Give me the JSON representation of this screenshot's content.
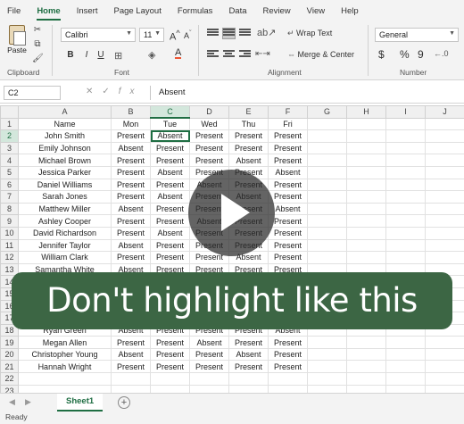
{
  "ribbon": {
    "tabs": [
      "File",
      "Home",
      "Insert",
      "Page Layout",
      "Formulas",
      "Data",
      "Review",
      "View",
      "Help"
    ],
    "active_tab": "Home",
    "clipboard": {
      "paste_label": "Paste",
      "group_label": "Clipboard"
    },
    "font": {
      "name": "Calibri",
      "size": "11",
      "group_label": "Font"
    },
    "alignment": {
      "wrap_text": "Wrap Text",
      "merge_center": "Merge & Center",
      "group_label": "Alignment"
    },
    "number": {
      "format": "General",
      "currency_symbol": "$",
      "percent_symbol": "%",
      "comma_symbol": "9",
      "group_label": "Number"
    }
  },
  "formula_bar": {
    "name_box": "C2",
    "fx_label": "fx",
    "value": "Absent"
  },
  "grid": {
    "column_headers": [
      "A",
      "B",
      "C",
      "D",
      "E",
      "F",
      "G",
      "H",
      "I",
      "J"
    ],
    "selected_column": "C",
    "selected_row": "2",
    "rows": [
      {
        "num": "1",
        "cells": [
          "Name",
          "Mon",
          "Tue",
          "Wed",
          "Thu",
          "Fri",
          "",
          "",
          "",
          ""
        ]
      },
      {
        "num": "2",
        "cells": [
          "John Smith",
          "Present",
          "Absent",
          "Present",
          "Present",
          "Present",
          "",
          "",
          "",
          ""
        ]
      },
      {
        "num": "3",
        "cells": [
          "Emily Johnson",
          "Absent",
          "Present",
          "Present",
          "Present",
          "Present",
          "",
          "",
          "",
          ""
        ]
      },
      {
        "num": "4",
        "cells": [
          "Michael Brown",
          "Present",
          "Present",
          "Present",
          "Absent",
          "Present",
          "",
          "",
          "",
          ""
        ]
      },
      {
        "num": "5",
        "cells": [
          "Jessica Parker",
          "Present",
          "Absent",
          "Present",
          "Present",
          "Absent",
          "",
          "",
          "",
          ""
        ]
      },
      {
        "num": "6",
        "cells": [
          "Daniel Williams",
          "Present",
          "Present",
          "Absent",
          "Present",
          "Present",
          "",
          "",
          "",
          ""
        ]
      },
      {
        "num": "7",
        "cells": [
          "Sarah Jones",
          "Present",
          "Absent",
          "Present",
          "Absent",
          "Present",
          "",
          "",
          "",
          ""
        ]
      },
      {
        "num": "8",
        "cells": [
          "Matthew Miller",
          "Absent",
          "Present",
          "Present",
          "Present",
          "Absent",
          "",
          "",
          "",
          ""
        ]
      },
      {
        "num": "9",
        "cells": [
          "Ashley Cooper",
          "Present",
          "Present",
          "Absent",
          "Present",
          "Present",
          "",
          "",
          "",
          ""
        ]
      },
      {
        "num": "10",
        "cells": [
          "David Richardson",
          "Present",
          "Absent",
          "Present",
          "Present",
          "Present",
          "",
          "",
          "",
          ""
        ]
      },
      {
        "num": "11",
        "cells": [
          "Jennifer Taylor",
          "Absent",
          "Present",
          "Present",
          "Present",
          "Present",
          "",
          "",
          "",
          ""
        ]
      },
      {
        "num": "12",
        "cells": [
          "William Clark",
          "Present",
          "Present",
          "Present",
          "Absent",
          "Present",
          "",
          "",
          "",
          ""
        ]
      },
      {
        "num": "13",
        "cells": [
          "Samantha White",
          "Absent",
          "Present",
          "Present",
          "Present",
          "Present",
          "",
          "",
          "",
          ""
        ]
      },
      {
        "num": "14",
        "cells": [
          "",
          "",
          "",
          "",
          "",
          "",
          "",
          "",
          "",
          ""
        ]
      },
      {
        "num": "15",
        "cells": [
          "",
          "",
          "",
          "",
          "",
          "",
          "",
          "",
          "",
          ""
        ]
      },
      {
        "num": "16",
        "cells": [
          "",
          "",
          "",
          "",
          "",
          "",
          "",
          "",
          "",
          ""
        ]
      },
      {
        "num": "17",
        "cells": [
          "",
          "",
          "",
          "",
          "",
          "",
          "",
          "",
          "",
          ""
        ]
      },
      {
        "num": "18",
        "cells": [
          "Ryan Green",
          "Absent",
          "Present",
          "Present",
          "Present",
          "Absent",
          "",
          "",
          "",
          ""
        ]
      },
      {
        "num": "19",
        "cells": [
          "Megan Allen",
          "Present",
          "Present",
          "Absent",
          "Present",
          "Present",
          "",
          "",
          "",
          ""
        ]
      },
      {
        "num": "20",
        "cells": [
          "Christopher Young",
          "Absent",
          "Present",
          "Present",
          "Absent",
          "Present",
          "",
          "",
          "",
          ""
        ]
      },
      {
        "num": "21",
        "cells": [
          "Hannah Wright",
          "Present",
          "Present",
          "Present",
          "Present",
          "Present",
          "",
          "",
          "",
          ""
        ]
      },
      {
        "num": "22",
        "cells": [
          "",
          "",
          "",
          "",
          "",
          "",
          "",
          "",
          "",
          ""
        ]
      },
      {
        "num": "23",
        "cells": [
          "",
          "",
          "",
          "",
          "",
          "",
          "",
          "",
          "",
          ""
        ]
      }
    ]
  },
  "sheets": {
    "tabs": [
      "Sheet1"
    ],
    "add_label": "+"
  },
  "status": {
    "text": "Ready"
  },
  "overlay": {
    "caption": "Don't highlight like this"
  },
  "colors": {
    "accent": "#1f6e43",
    "caption_bg": "#3c6644"
  },
  "icons": [
    "paste-icon",
    "cut-icon",
    "copy-icon",
    "format-painter-icon",
    "play-icon",
    "add-sheet-icon"
  ]
}
